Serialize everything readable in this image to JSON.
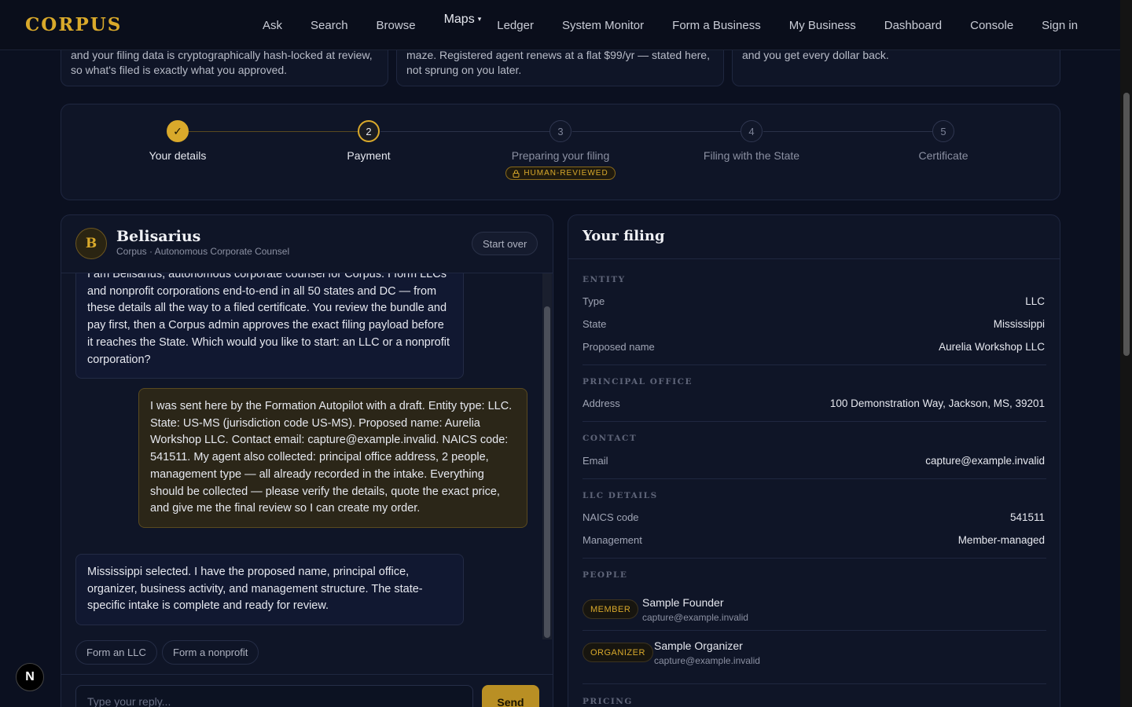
{
  "nav": {
    "logo": "CORPUS",
    "links": [
      "Ask",
      "Search",
      "Browse",
      "Maps",
      "Ledger",
      "System Monitor",
      "Form a Business",
      "My Business",
      "Dashboard",
      "Console",
      "Sign in"
    ]
  },
  "features": [
    {
      "line1": "and your filing data is cryptographically hash-locked at review,",
      "line2": "so what's filed is exactly what you approved."
    },
    {
      "line1": "maze. Registered agent renews at a flat $99/yr — stated here,",
      "line2": "not sprung on you later."
    },
    {
      "line1": "and you get every dollar back.",
      "line2": ""
    }
  ],
  "stepper": {
    "steps": [
      {
        "num": "✓",
        "label": "Your details",
        "state": "done"
      },
      {
        "num": "2",
        "label": "Payment",
        "state": "active"
      },
      {
        "num": "3",
        "label": "Preparing your filing",
        "state": "pending",
        "badge": "HUMAN-REVIEWED"
      },
      {
        "num": "4",
        "label": "Filing with the State",
        "state": "pending"
      },
      {
        "num": "5",
        "label": "Certificate",
        "state": "pending"
      }
    ]
  },
  "chat": {
    "avatar": "B",
    "name": "Belisarius",
    "subtitle": "Corpus · Autonomous Corporate Counsel",
    "start_over": "Start over",
    "messages": [
      {
        "role": "agent",
        "text": "I am Belisarius, autonomous corporate counsel for Corpus. I form LLCs and nonprofit corporations end-to-end in all 50 states and DC — from these details all the way to a filed certificate. You review the bundle and pay first, then a Corpus admin approves the exact filing payload before it reaches the State. Which would you like to start: an LLC or a nonprofit corporation?"
      },
      {
        "role": "user",
        "text": "I was sent here by the Formation Autopilot with a draft. Entity type: LLC. State: US-MS (jurisdiction code US-MS). Proposed name: Aurelia Workshop LLC. Contact email: capture@example.invalid. NAICS code: 541511. My agent also collected: principal office address, 2 people, management type — all already recorded in the intake. Everything should be collected — please verify the details, quote the exact price, and give me the final review so I can create my order."
      },
      {
        "role": "agent",
        "text": "Mississippi selected. I have the proposed name, principal office, organizer, business activity, and management structure. The state-specific intake is complete and ready for review."
      }
    ],
    "chips": [
      "Form an LLC",
      "Form a nonprofit"
    ],
    "input_placeholder": "Type your reply...",
    "send": "Send"
  },
  "filing": {
    "title": "Your filing",
    "entity_label": "ENTITY",
    "type_k": "Type",
    "type_v": "LLC",
    "state_k": "State",
    "state_v": "Mississippi",
    "name_k": "Proposed name",
    "name_v": "Aurelia Workshop LLC",
    "office_label": "PRINCIPAL OFFICE",
    "address_k": "Address",
    "address_v": "100 Demonstration Way, Jackson, MS, 39201",
    "contact_label": "CONTACT",
    "email_k": "Email",
    "email_v": "capture@example.invalid",
    "llc_label": "LLC DETAILS",
    "naics_k": "NAICS code",
    "naics_v": "541511",
    "mgmt_k": "Management",
    "mgmt_v": "Member-managed",
    "people_label": "PEOPLE",
    "people": [
      {
        "role": "MEMBER",
        "name": "Sample Founder",
        "email": "capture@example.invalid"
      },
      {
        "role": "ORGANIZER",
        "name": "Sample Organizer",
        "email": "capture@example.invalid"
      }
    ],
    "pricing_label": "PRICING"
  },
  "badge_n": "N"
}
